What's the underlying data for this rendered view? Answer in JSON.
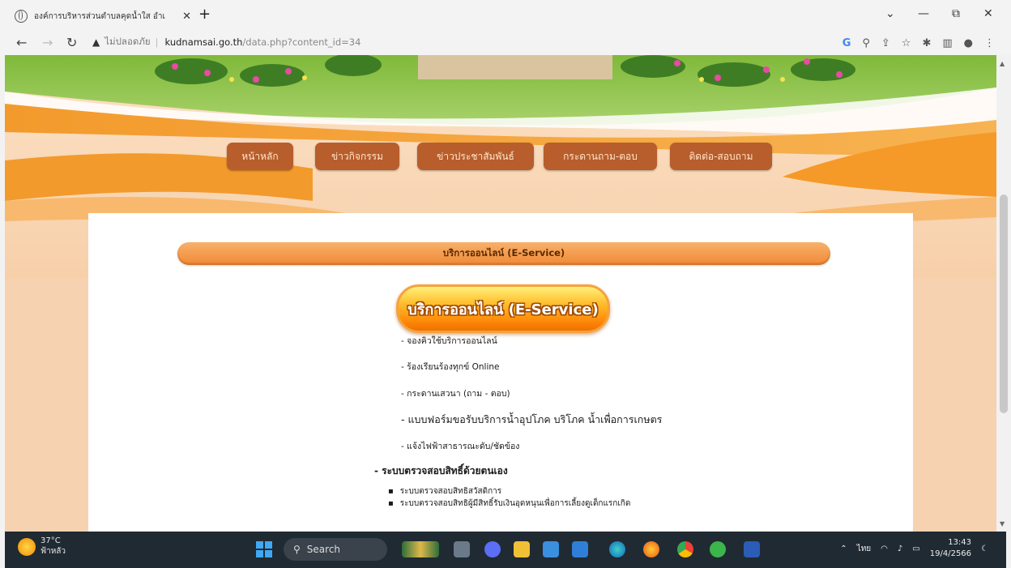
{
  "browser": {
    "tab_title": "องค์การบริหารส่วนตำบลคุดน้ำใส อำเ",
    "tab_close": "✕",
    "new_tab": "+",
    "insecure_label": "ไม่ปลอดภัย",
    "url_host": "kudnamsai.go.th",
    "url_path": "/data.php?content_id=34",
    "window_controls": [
      "⌄",
      "—",
      "⧉",
      "✕"
    ]
  },
  "nav_menu": [
    "หน้าหลัก",
    "ข่าวกิจกรรม",
    "ข่าวประชาสัมพันธ์",
    "กระดานถาม-ตอบ",
    "ติดต่อ-สอบถาม"
  ],
  "content": {
    "header_pill": "บริการออนไลน์ (E-Service)",
    "big_button": "บริการออนไลน์ (E-Service)",
    "services": [
      "- จองคิวใช้บริการออนไลน์",
      "- ร้องเรียนร้องทุกข์ Online",
      "- กระดานเสวนา (ถาม - ตอบ)",
      "- แบบฟอร์มขอรับบริการน้ำอุปโภค บริโภค น้ำเพื่อการเกษตร",
      "- แจ้งไฟฟ้าสาธารณะดับ/ชัดข้อง"
    ],
    "section_title": "- ระบบตรวจสอบสิทธิ์ด้วยตนเอง",
    "bullets": [
      "ระบบตรวจสอบสิทธิสวัสดิการ",
      "ระบบตรวจสอบสิทธิผู้มีสิทธิ์รับเงินอุดหนุนเพื่อการเลี้ยงดูเด็กแรกเกิด"
    ]
  },
  "taskbar": {
    "temperature": "37°C",
    "weather_label": "ฟ้าหลัว",
    "search_label": "Search",
    "language": "ไทย",
    "time": "13:43",
    "date": "19/4/2566"
  },
  "colors": {
    "menu_button": "#b85d2c",
    "pill_orange": "#f08a36",
    "background_peach": "#f6d2b0",
    "taskbar": "#202a32"
  }
}
